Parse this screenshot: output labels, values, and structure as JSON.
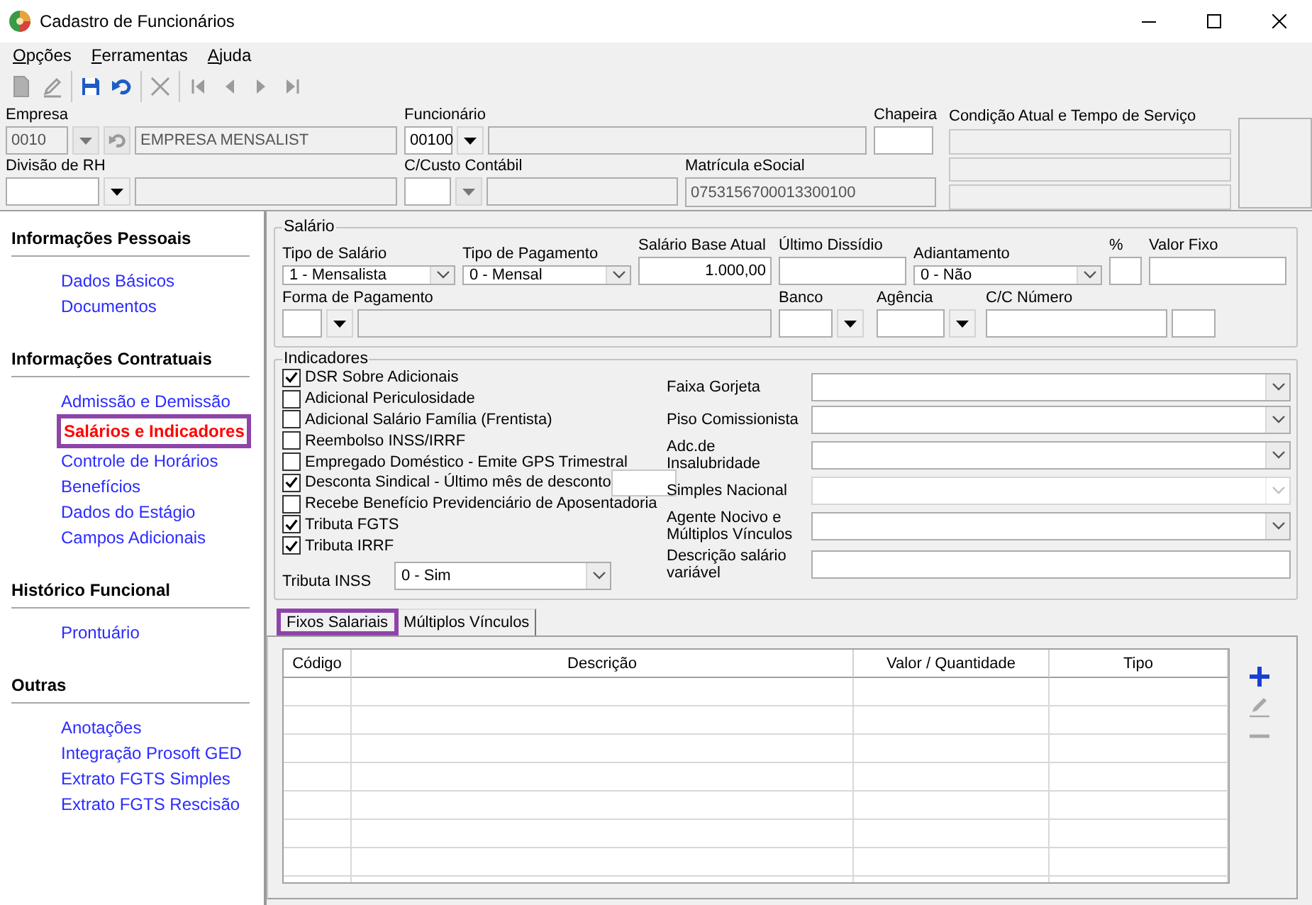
{
  "window": {
    "title": "Cadastro de Funcionários"
  },
  "menu": [
    {
      "label": "Opções"
    },
    {
      "label": "Ferramentas"
    },
    {
      "label": "Ajuda"
    }
  ],
  "toolbar": [
    {
      "buttons": [
        {
          "kind": "new",
          "disabled": true
        },
        {
          "kind": "edit",
          "disabled": true
        }
      ]
    },
    {
      "buttons": [
        {
          "kind": "save",
          "disabled": false
        },
        {
          "kind": "undo",
          "disabled": false
        }
      ]
    },
    {
      "buttons": [
        {
          "kind": "delete",
          "disabled": true
        }
      ]
    },
    {
      "buttons": [
        {
          "kind": "first",
          "disabled": true
        },
        {
          "kind": "previous",
          "disabled": true
        },
        {
          "kind": "next",
          "disabled": true
        },
        {
          "kind": "last",
          "disabled": true
        }
      ]
    }
  ],
  "header": {
    "empresa": {
      "label": "Empresa",
      "code": {
        "value": "0010",
        "disabled": true
      },
      "dropdown": {
        "disabled": true
      },
      "undo": {
        "disabled": true
      },
      "name": {
        "value": "EMPRESA MENSALIST",
        "disabled": true
      }
    },
    "funcionario": {
      "label": "Funcionário",
      "code": {
        "value": "00100",
        "disabled": false
      },
      "dropdown": {
        "disabled": false
      },
      "name": {
        "disabled": true
      }
    },
    "chapeira": {
      "label": "Chapeira",
      "field": {
        "disabled": false
      }
    },
    "divisao_rh": {
      "label": "Divisão de RH",
      "code": {
        "disabled": false
      },
      "dropdown": {
        "disabled": false
      },
      "name": {
        "disabled": true
      }
    },
    "centro_custo": {
      "label": "C/Custo Contábil",
      "code": {
        "disabled": false
      },
      "dropdown": {
        "disabled": true
      },
      "name": {
        "disabled": true
      }
    },
    "matricula_esocial": {
      "label": "Matrícula eSocial",
      "field": {
        "value": "0753156700013300100",
        "disabled": true
      }
    },
    "condicao": {
      "label": "Condição Atual e Tempo de Serviço"
    }
  },
  "sidebar": [
    {
      "title": "Informações Pessoais",
      "items": [
        {
          "label": "Dados Básicos",
          "selected": false
        },
        {
          "label": "Documentos",
          "selected": false
        }
      ]
    },
    {
      "title": "Informações Contratuais",
      "items": [
        {
          "label": "Admissão e Demissão",
          "selected": false
        },
        {
          "label": "Salários e Indicadores",
          "selected": true
        },
        {
          "label": "Controle de Horários",
          "selected": false
        },
        {
          "label": "Benefícios",
          "selected": false
        },
        {
          "label": "Dados do Estágio",
          "selected": false
        },
        {
          "label": "Campos Adicionais",
          "selected": false
        }
      ]
    },
    {
      "title": "Histórico Funcional",
      "items": [
        {
          "label": "Prontuário",
          "selected": false
        }
      ]
    },
    {
      "title": "Outras",
      "items": [
        {
          "label": "Anotações",
          "selected": false
        },
        {
          "label": "Integração Prosoft GED",
          "selected": false
        },
        {
          "label": "Extrato FGTS Simples",
          "selected": false
        },
        {
          "label": "Extrato FGTS Rescisão",
          "selected": false
        }
      ]
    }
  ],
  "salario": {
    "title": "Salário",
    "tipo_salario": {
      "label": "Tipo de Salário",
      "value": "1 - Mensalista"
    },
    "tipo_pagamento": {
      "label": "Tipo de Pagamento",
      "value": "0 - Mensal"
    },
    "salario_base": {
      "label": "Salário Base Atual",
      "value": "1.000,00"
    },
    "ultimo_dissidio": {
      "label": "Último Dissídio"
    },
    "adiantamento": {
      "label": "Adiantamento",
      "value": "0 - Não"
    },
    "percentual": {
      "label": "%"
    },
    "valor_fixo": {
      "label": "Valor Fixo"
    },
    "forma_pagamento": {
      "label": "Forma de Pagamento",
      "description": {
        "disabled": true
      }
    },
    "banco": {
      "label": "Banco"
    },
    "agencia": {
      "label": "Agência"
    },
    "cc_numero": {
      "label": "C/C Número"
    }
  },
  "indicadores": {
    "title": "Indicadores",
    "checks": [
      {
        "label": "DSR Sobre Adicionais",
        "checked": true,
        "kind": "check"
      },
      {
        "label": "Adicional Periculosidade",
        "checked": false,
        "kind": "check"
      },
      {
        "label": "Adicional Salário Família (Frentista)",
        "checked": false,
        "kind": "check"
      },
      {
        "label": "Reembolso INSS/IRRF",
        "checked": false,
        "kind": "check"
      },
      {
        "label": "Empregado Doméstico - Emite GPS Trimestral",
        "checked": false,
        "kind": "check"
      },
      {
        "label": "Desconta Sindical - Último mês de desconto",
        "checked": true,
        "kind": "check_field"
      },
      {
        "label": "Recebe Benefício Previdenciário de Aposentadoria",
        "checked": false,
        "kind": "check"
      },
      {
        "label": "Tributa FGTS",
        "checked": true,
        "kind": "check"
      },
      {
        "label": "Tributa IRRF",
        "checked": true,
        "kind": "check"
      }
    ],
    "tributa_inss": {
      "label": "Tributa INSS",
      "value": "0 - Sim"
    },
    "options": [
      {
        "label": "Faixa Gorjeta",
        "kind": "combo",
        "disabled": false
      },
      {
        "label": "Piso Comissionista",
        "kind": "combo",
        "disabled": false
      },
      {
        "label": "Adc.de Insalubridade",
        "kind": "combo",
        "disabled": false
      },
      {
        "label": "Simples Nacional",
        "kind": "combo",
        "disabled": true
      },
      {
        "label": "Agente Nocivo e Múltiplos Vínculos",
        "kind": "combo",
        "disabled": false
      },
      {
        "label": "Descrição salário variável",
        "kind": "text",
        "disabled": false
      }
    ]
  },
  "tabs": [
    {
      "label": "Fixos Salariais",
      "selected": true
    },
    {
      "label": "Múltiplos Vínculos",
      "selected": false
    }
  ],
  "table": {
    "columns": [
      "Código",
      "Descrição",
      "Valor / Quantidade",
      "Tipo"
    ]
  },
  "row_actions": [
    {
      "kind": "add",
      "disabled": false
    },
    {
      "kind": "edit",
      "disabled": true
    },
    {
      "kind": "remove",
      "disabled": true
    }
  ]
}
